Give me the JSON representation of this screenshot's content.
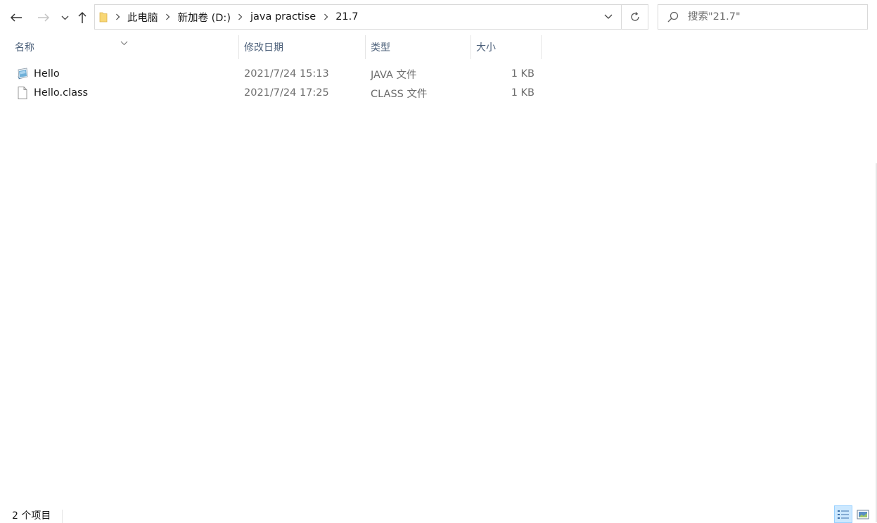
{
  "navigation": {
    "back_icon": "arrow-left",
    "forward_icon": "arrow-right",
    "recent_icon": "chevron-down",
    "up_icon": "arrow-up"
  },
  "address_bar": {
    "folder_icon": "folder",
    "breadcrumbs": [
      "此电脑",
      "新加卷 (D:)",
      "java practise",
      "21.7"
    ],
    "dropdown_icon": "chevron-down",
    "refresh_icon": "refresh"
  },
  "search": {
    "icon": "magnifier",
    "placeholder": "搜索\"21.7\""
  },
  "columns": {
    "name": "名称",
    "date": "修改日期",
    "type": "类型",
    "size": "大小",
    "sort_indicator_icon": "chevron-down"
  },
  "files": [
    {
      "name": "Hello",
      "date": "2021/7/24 15:13",
      "type": "JAVA 文件",
      "size": "1 KB",
      "icon": "java-file"
    },
    {
      "name": "Hello.class",
      "date": "2021/7/24 17:25",
      "type": "CLASS 文件",
      "size": "1 KB",
      "icon": "blank-file"
    }
  ],
  "status_bar": {
    "item_count": "2 个项目",
    "details_view_icon": "details-view",
    "large_icons_view_icon": "large-icons-view"
  },
  "colors": {
    "header_text": "#4c607a",
    "meta_text": "#6d6d6d",
    "folder_yellow": "#f8d775",
    "active_view_bg": "#cce8ff"
  }
}
